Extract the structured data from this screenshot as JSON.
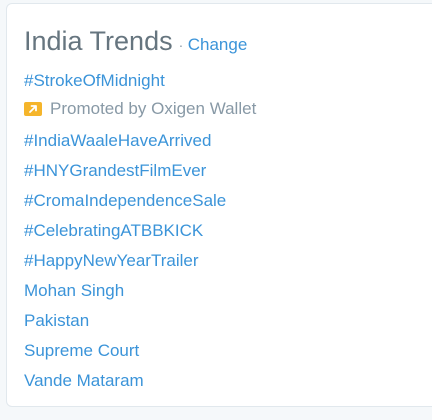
{
  "header": {
    "title": "India Trends",
    "separator": "·",
    "change_label": "Change"
  },
  "promoted_trend": {
    "label": "#StrokeOfMidnight",
    "promoted_text": "Promoted by Oxigen Wallet",
    "icon": "promoted-arrow-icon",
    "icon_color": "#f5b52b"
  },
  "trends": [
    "#IndiaWaaleHaveArrived",
    "#HNYGrandestFilmEver",
    "#CromaIndependenceSale",
    "#CelebratingATBBKICK",
    "#HappyNewYearTrailer",
    "Mohan Singh",
    "Pakistan",
    "Supreme Court",
    "Vande Mataram"
  ],
  "colors": {
    "link": "#3b94d9",
    "title": "#66757f",
    "muted": "#8899a6",
    "border": "#e1e8ed"
  }
}
